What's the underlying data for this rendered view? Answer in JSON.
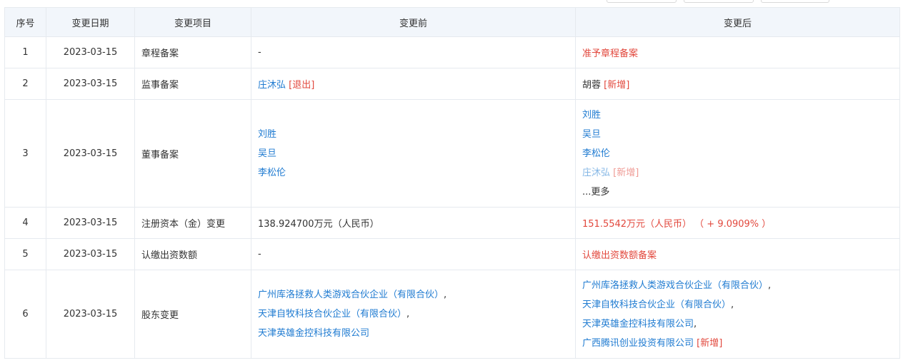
{
  "headers": [
    "序号",
    "变更日期",
    "变更项目",
    "变更前",
    "变更后"
  ],
  "rows": [
    {
      "index": "1",
      "date": "2023-03-15",
      "item": "章程备案",
      "before": [
        {
          "text": "-",
          "type": "plain"
        }
      ],
      "after": [
        {
          "text": "准予章程备案",
          "type": "red"
        }
      ]
    },
    {
      "index": "2",
      "date": "2023-03-15",
      "item": "监事备案",
      "before": [
        {
          "text": "庄沐弘",
          "type": "link",
          "tag": "[退出]"
        }
      ],
      "after": [
        {
          "text": "胡蓉",
          "type": "plain",
          "tag": "[新增]"
        }
      ]
    },
    {
      "index": "3",
      "date": "2023-03-15",
      "item": "董事备案",
      "before": [
        {
          "text": "刘胜",
          "type": "link"
        },
        {
          "text": "吴旦",
          "type": "link"
        },
        {
          "text": "李松伦",
          "type": "link"
        }
      ],
      "after": [
        {
          "text": "刘胜",
          "type": "link"
        },
        {
          "text": "吴旦",
          "type": "link"
        },
        {
          "text": "李松伦",
          "type": "link"
        },
        {
          "text": "庄沐弘",
          "type": "link",
          "tag": "[新增]",
          "faded": true
        }
      ],
      "more_label": "...更多"
    },
    {
      "index": "4",
      "date": "2023-03-15",
      "item": "注册资本（金）变更",
      "before": [
        {
          "text": "138.924700万元（人民币）",
          "type": "plain"
        }
      ],
      "after": [
        {
          "text": "151.5542万元（人民币） （ + 9.0909% ）",
          "type": "red"
        }
      ]
    },
    {
      "index": "5",
      "date": "2023-03-15",
      "item": "认缴出资数额",
      "before": [
        {
          "text": "-",
          "type": "plain"
        }
      ],
      "after": [
        {
          "text": "认缴出资数额备案",
          "type": "red"
        }
      ]
    },
    {
      "index": "6",
      "date": "2023-03-15",
      "item": "股东变更",
      "before": [
        {
          "text": "广州库洛拯救人类游戏合伙企业（有限合伙）",
          "type": "link",
          "suffix": ","
        },
        {
          "text": "天津自牧科技合伙企业（有限合伙）",
          "type": "link",
          "suffix": ","
        },
        {
          "text": "天津英雄金控科技有限公司",
          "type": "link"
        }
      ],
      "after": [
        {
          "text": "广州库洛拯救人类游戏合伙企业（有限合伙）",
          "type": "link",
          "suffix": ","
        },
        {
          "text": "天津自牧科技合伙企业（有限合伙）",
          "type": "link",
          "suffix": ","
        },
        {
          "text": "天津英雄金控科技有限公司",
          "type": "link",
          "suffix": ","
        },
        {
          "text": "广西腾讯创业投资有限公司",
          "type": "link",
          "tag": "[新增]"
        }
      ]
    }
  ]
}
